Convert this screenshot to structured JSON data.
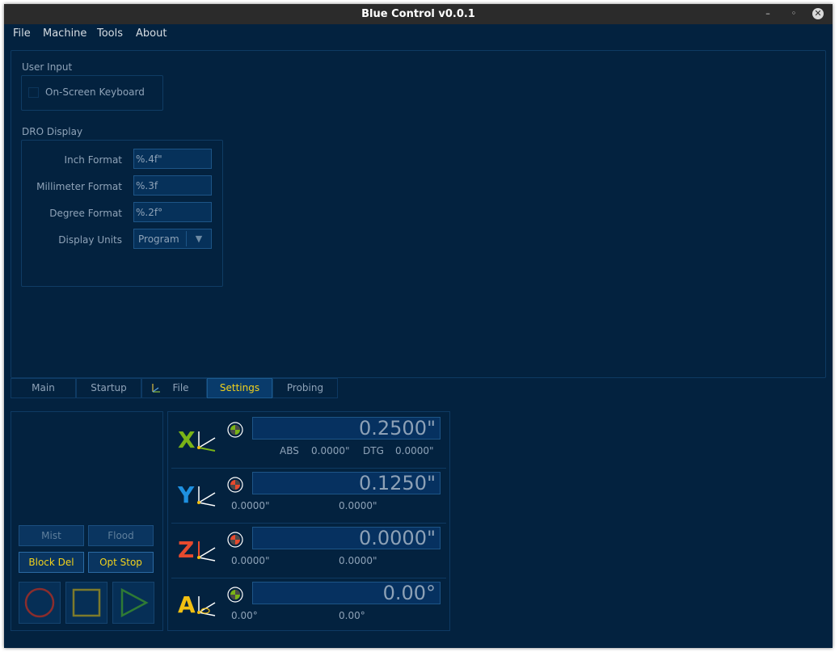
{
  "window": {
    "title": "Blue Control v0.0.1",
    "minimize": "–",
    "restore": "◦",
    "close": "✕"
  },
  "menu": [
    "File",
    "Machine",
    "Tools",
    "About"
  ],
  "settings": {
    "user_input": {
      "title": "User Input",
      "keyboard_label": "On-Screen Keyboard"
    },
    "dro_display": {
      "title": "DRO Display",
      "inch_label": "Inch Format",
      "inch_value": "%.4f\"",
      "mm_label": "Millimeter Format",
      "mm_value": "%.3f",
      "deg_label": "Degree Format",
      "deg_value": "%.2f°",
      "units_label": "Display Units",
      "units_value": "Program"
    }
  },
  "tabs": [
    {
      "label": "Main"
    },
    {
      "label": "Startup"
    },
    {
      "label": "File"
    },
    {
      "label": "Settings",
      "active": true
    },
    {
      "label": "Probing"
    }
  ],
  "controls": {
    "mist": "Mist",
    "flood": "Flood",
    "block_del": "Block Del",
    "opt_stop": "Opt Stop"
  },
  "dro": [
    {
      "axis": "X",
      "color": "#7ab317",
      "value": "0.2500\"",
      "abs_label": "ABS",
      "abs": "0.0000\"",
      "dtg_label": "DTG",
      "dtg": "0.0000\""
    },
    {
      "axis": "Y",
      "color": "#1e90e0",
      "value": "0.1250\"",
      "abs": "0.0000\"",
      "dtg": "0.0000\""
    },
    {
      "axis": "Z",
      "color": "#e64a2e",
      "value": "0.0000\"",
      "abs": "0.0000\"",
      "dtg": "0.0000\""
    },
    {
      "axis": "A",
      "color": "#f2c012",
      "value": "0.00°",
      "abs": "0.00°",
      "dtg": "0.00°"
    }
  ],
  "colors": {
    "background": "#03223f",
    "accent": "#f2d21c",
    "titlebar": "#2b2b2b"
  }
}
